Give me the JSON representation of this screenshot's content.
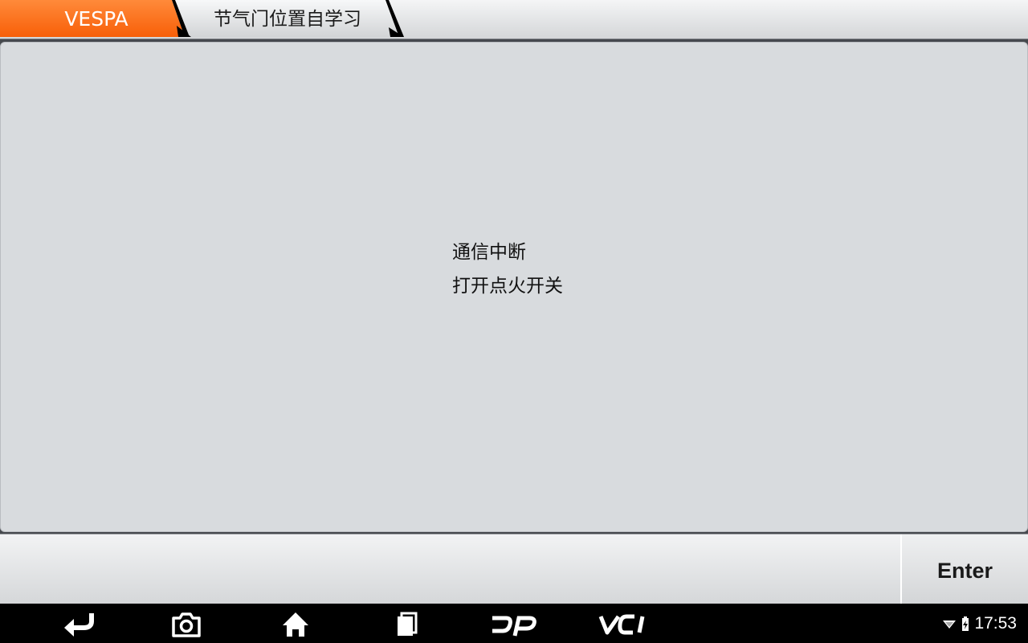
{
  "header": {
    "brand": "VESPA",
    "page_title": "节气门位置自学习"
  },
  "message": {
    "lines": [
      "通信中断",
      "打开点火开关"
    ]
  },
  "actions": {
    "enter_label": "Enter"
  },
  "navbar": {
    "buttons": [
      {
        "name": "back-icon"
      },
      {
        "name": "camera-icon"
      },
      {
        "name": "home-icon"
      },
      {
        "name": "recent-apps-icon"
      },
      {
        "name": "dp-icon"
      },
      {
        "name": "vci-icon"
      }
    ]
  },
  "status": {
    "time": "17:53",
    "icons": [
      "wifi-icon",
      "battery-charging-icon"
    ]
  },
  "colors": {
    "brand_orange": "#ff6a13",
    "content_bg": "#d8dbde",
    "navbar_bg": "#000000"
  }
}
